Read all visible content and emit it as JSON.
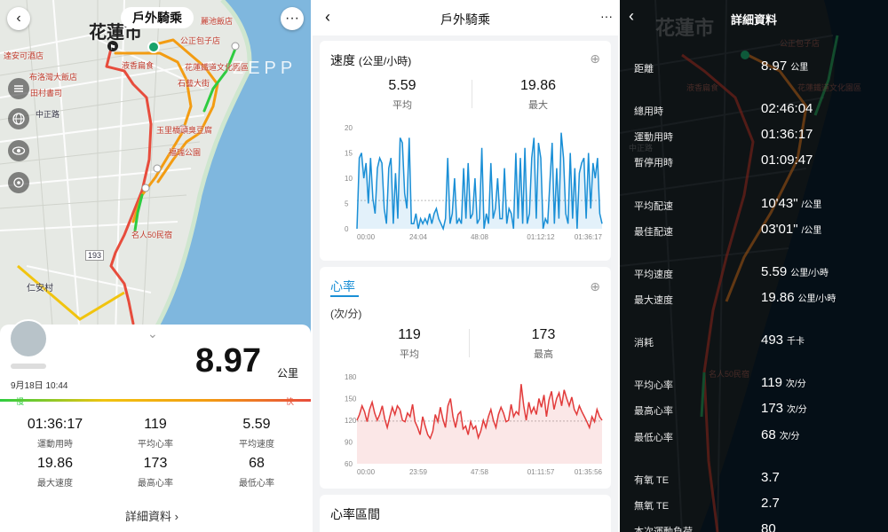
{
  "panel1": {
    "title": "戶外騎乘",
    "watermark": "ZEPP",
    "city": "花蓮市",
    "map_labels": [
      "麗池飯店",
      "公正包子店",
      "達安可酒店",
      "布洛灣大飯店",
      "液香扁食",
      "花蓮鐵道文化園區",
      "田村書司",
      "石藝大街",
      "中正路",
      "玉里橋頭臭豆腐",
      "福瑞公園",
      "名人50民宿",
      "193",
      "仁安村"
    ],
    "date": "9月18日 10:44",
    "distance": "8.97",
    "distance_unit": "公里",
    "speed_slow": "慢",
    "speed_fast": "快",
    "stats": [
      {
        "value": "01:36:17",
        "label": "運動用時"
      },
      {
        "value": "119",
        "label": "平均心率"
      },
      {
        "value": "5.59",
        "label": "平均速度"
      },
      {
        "value": "19.86",
        "label": "最大速度"
      },
      {
        "value": "173",
        "label": "最高心率"
      },
      {
        "value": "68",
        "label": "最低心率"
      }
    ],
    "details_link": "詳細資料",
    "colors": {
      "route_fast": "#2ecc40",
      "route_mid": "#f39c12",
      "route_slow": "#e74c3c",
      "start": "#1aa36b"
    }
  },
  "panel2": {
    "title": "戶外騎乘",
    "speed_card": {
      "title": "速度",
      "unit": "(公里/小時)",
      "avg": "5.59",
      "avg_label": "平均",
      "max": "19.86",
      "max_label": "最大",
      "color": "#1a8fd6",
      "chart_data": {
        "type": "area",
        "x_ticks": [
          "00:00",
          "24:04",
          "48:08",
          "01:12:12",
          "01:36:17"
        ],
        "y_ticks": [
          "0",
          "5",
          "10",
          "15",
          "20"
        ],
        "ylim": [
          0,
          20
        ],
        "values": [
          0,
          14,
          15,
          10,
          13,
          5,
          14,
          6,
          3,
          12,
          14,
          13,
          4,
          1,
          12,
          14,
          1,
          11,
          2,
          18,
          17,
          7,
          4,
          18,
          1,
          1,
          3,
          0,
          2,
          1,
          2,
          1,
          3,
          1,
          3,
          4,
          2,
          1,
          0,
          2,
          14,
          1,
          3,
          10,
          1,
          2,
          1,
          12,
          2,
          13,
          2,
          3,
          10,
          1,
          2,
          16,
          0,
          3,
          1,
          13,
          2,
          4,
          10,
          2,
          2,
          12,
          1,
          4,
          3,
          0,
          15,
          2,
          14,
          1,
          16,
          1,
          3,
          14,
          18,
          2,
          17,
          14,
          0,
          2,
          1,
          9,
          17,
          1,
          12,
          2,
          19,
          14,
          3,
          1,
          15,
          2,
          12,
          0,
          11,
          13,
          14,
          2,
          15,
          4,
          13,
          10,
          14,
          3,
          1
        ]
      }
    },
    "hr_card": {
      "title": "心率",
      "unit": "(次/分)",
      "avg": "119",
      "avg_label": "平均",
      "max": "173",
      "max_label": "最高",
      "color": "#e23b3b",
      "chart_data": {
        "type": "area",
        "x_ticks": [
          "00:00",
          "23:59",
          "47:58",
          "01:11:57",
          "01:35:56"
        ],
        "y_ticks": [
          "60",
          "90",
          "120",
          "150",
          "180"
        ],
        "ylim": [
          60,
          180
        ],
        "values": [
          120,
          128,
          140,
          132,
          118,
          135,
          145,
          130,
          120,
          128,
          140,
          122,
          110,
          125,
          138,
          128,
          140,
          135,
          120,
          118,
          130,
          125,
          142,
          118,
          110,
          100,
          125,
          112,
          100,
          95,
          105,
          128,
          118,
          138,
          122,
          110,
          140,
          150,
          125,
          110,
          128,
          132,
          108,
          112,
          100,
          118,
          108,
          112,
          96,
          105,
          120,
          110,
          125,
          135,
          120,
          110,
          128,
          138,
          130,
          118,
          120,
          142,
          125,
          132,
          128,
          170,
          140,
          120,
          145,
          130,
          138,
          128,
          150,
          138,
          155,
          125,
          148,
          160,
          135,
          150,
          158,
          140,
          162,
          150,
          140,
          152,
          135,
          128,
          140,
          132,
          125,
          118,
          110,
          125,
          118,
          135,
          125,
          120
        ]
      }
    },
    "zone_title": "心率區間"
  },
  "panel3": {
    "title": "詳細資料",
    "rows": [
      {
        "key": "距離",
        "value": "8.97",
        "unit": "公里"
      },
      {
        "key": "總用時",
        "value": "02:46:04",
        "unit": ""
      },
      {
        "key": "運動用時",
        "value": "01:36:17",
        "unit": ""
      },
      {
        "key": "暫停用時",
        "value": "01:09:47",
        "unit": ""
      },
      {
        "key": "平均配速",
        "value": "10'43\"",
        "unit": "/公里"
      },
      {
        "key": "最佳配速",
        "value": "03'01\"",
        "unit": "/公里"
      },
      {
        "key": "平均速度",
        "value": "5.59",
        "unit": "公里/小時"
      },
      {
        "key": "最大速度",
        "value": "19.86",
        "unit": "公里/小時"
      },
      {
        "key": "消耗",
        "value": "493",
        "unit": "千卡"
      },
      {
        "key": "平均心率",
        "value": "119",
        "unit": "次/分"
      },
      {
        "key": "最高心率",
        "value": "173",
        "unit": "次/分"
      },
      {
        "key": "最低心率",
        "value": "68",
        "unit": "次/分"
      },
      {
        "key": "有氧 TE",
        "value": "3.7",
        "unit": ""
      },
      {
        "key": "無氧 TE",
        "value": "2.7",
        "unit": ""
      },
      {
        "key": "本次運動負荷",
        "value": "80",
        "unit": ""
      }
    ],
    "map_labels": [
      "花蓮市",
      "液香扁食",
      "花蓮鐵道文化園區",
      "公正包子店",
      "中正路",
      "名人50民宿"
    ]
  }
}
